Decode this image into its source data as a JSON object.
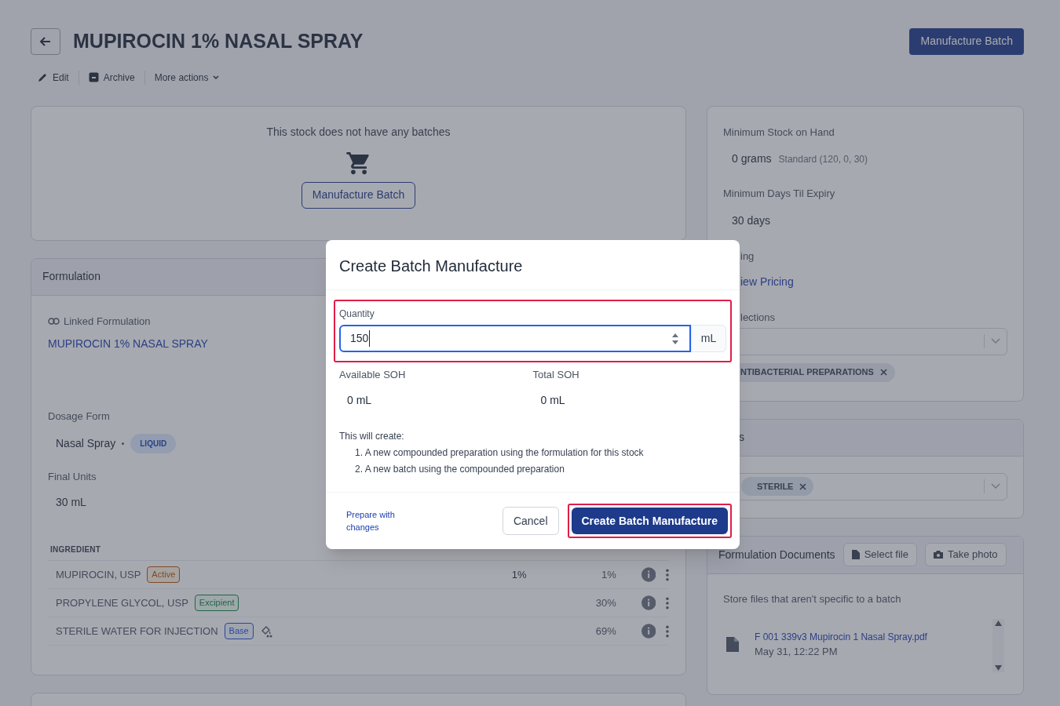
{
  "header": {
    "title": "MUPIROCIN 1% NASAL SPRAY",
    "primary_button": "Manufacture Batch",
    "actions": [
      {
        "kind": "edit",
        "label": "Edit"
      },
      {
        "kind": "archive",
        "label": "Archive"
      },
      {
        "kind": "more",
        "label": "More actions"
      }
    ]
  },
  "batches": {
    "empty_text": "This stock does not have any batches",
    "button": "Manufacture Batch"
  },
  "formulation": {
    "title": "Formulation",
    "linked_label": "Linked Formulation",
    "linked_value": "MUPIROCIN 1% NASAL SPRAY",
    "dosage_label": "Dosage Form",
    "dosage_value": "Nasal Spray",
    "dosage_tag": "LIQUID",
    "final_units_label": "Final Units",
    "final_units_value": "30 mL",
    "ingredient_heading": "INGREDIENT",
    "ingredients": [
      {
        "name": "MUPIROCIN, USP",
        "role": "Active",
        "kind": "active",
        "qs": false,
        "quantity": "1%",
        "percent": "1%"
      },
      {
        "name": "PROPYLENE GLYCOL, USP",
        "role": "Excipient",
        "kind": "excipient",
        "qs": false,
        "percent": "30%"
      },
      {
        "name": "STERILE WATER FOR INJECTION",
        "role": "Base",
        "kind": "base",
        "qs": true,
        "percent": "69%"
      }
    ]
  },
  "stock_settings": {
    "min_soh_label": "Minimum Stock on Hand",
    "min_soh_value": "0 grams",
    "min_soh_note": "Standard (120, 0, 30)",
    "min_days_label": "Minimum Days Til Expiry",
    "min_days_value": "30 days",
    "pricing_label": "ing",
    "pricing_link": "iew Pricing",
    "collections_label": "lections",
    "collections_chip": "NTIBACTERIAL PREPARATIONS"
  },
  "tags_card": {
    "title": "s",
    "chip": "STERILE"
  },
  "documents": {
    "title": "Formulation Documents",
    "select_file": "Select file",
    "take_photo": "Take photo",
    "hint": "Store files that aren't specific to a batch",
    "files": [
      {
        "name": "F 001 339v3 Mupirocin 1 Nasal Spray.pdf",
        "date": "May 31, 12:22 PM"
      }
    ]
  },
  "modal": {
    "title": "Create Batch Manufacture",
    "quantity_label": "Quantity",
    "quantity_value": "150",
    "unit": "mL",
    "available_label": "Available SOH",
    "available_value": "0 mL",
    "total_label": "Total SOH",
    "total_value": "0 mL",
    "intro": "This will create:",
    "steps": [
      "1. A new compounded preparation using the formulation for this stock",
      "2. A new batch using the compounded preparation"
    ],
    "prepare_link": "Prepare with changes",
    "cancel": "Cancel",
    "confirm": "Create Batch Manufacture"
  }
}
